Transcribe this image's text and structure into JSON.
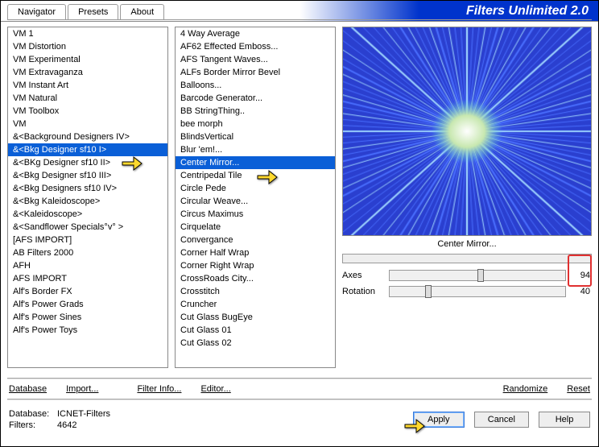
{
  "window": {
    "title": "Filters Unlimited 2.0"
  },
  "tabs": {
    "nav": "Navigator",
    "presets": "Presets",
    "about": "About"
  },
  "col1": {
    "items": [
      "VM 1",
      "VM Distortion",
      "VM Experimental",
      "VM Extravaganza",
      "VM Instant Art",
      "VM Natural",
      "VM Toolbox",
      "VM",
      "&<Background Designers IV>",
      "&<Bkg Designer sf10 I>",
      "&<BKg Designer sf10 II>",
      "&<Bkg Designer sf10 III>",
      "&<Bkg Designers sf10 IV>",
      "&<Bkg Kaleidoscope>",
      "&<Kaleidoscope>",
      "&<Sandflower Specials°v° >",
      "[AFS IMPORT]",
      "AB Filters 2000",
      "AFH",
      "AFS IMPORT",
      "Alf's Border FX",
      "Alf's Power Grads",
      "Alf's Power Sines",
      "Alf's Power Toys"
    ],
    "selected_index": 9
  },
  "col2": {
    "items": [
      "4 Way Average",
      "AF62 Effected Emboss...",
      "AFS Tangent Waves...",
      "ALFs Border Mirror Bevel",
      "Balloons...",
      "Barcode Generator...",
      "BB StringThing..",
      "bee morph",
      "BlindsVertical",
      "Blur 'em!...",
      "Center Mirror...",
      "Centripedal Tile",
      "Circle Pede",
      "Circular Weave...",
      "Circus Maximus",
      "Cirquelate",
      "Convergance",
      "Corner Half Wrap",
      "Corner Right Wrap",
      "CrossRoads City...",
      "Crosstitch",
      "Cruncher",
      "Cut Glass  BugEye",
      "Cut Glass 01",
      "Cut Glass 02"
    ],
    "selected_index": 10
  },
  "preview": {
    "label": "Center Mirror..."
  },
  "params": {
    "axes": {
      "label": "Axes",
      "value": 94
    },
    "rotation": {
      "label": "Rotation",
      "value": 40
    }
  },
  "links": {
    "database": "Database",
    "import": "Import...",
    "filterinfo": "Filter Info...",
    "editor": "Editor...",
    "randomize": "Randomize",
    "reset": "Reset"
  },
  "footer": {
    "database_lbl": "Database:",
    "database_val": "ICNET-Filters",
    "filters_lbl": "Filters:",
    "filters_val": "4642",
    "apply": "Apply",
    "cancel": "Cancel",
    "help": "Help"
  }
}
